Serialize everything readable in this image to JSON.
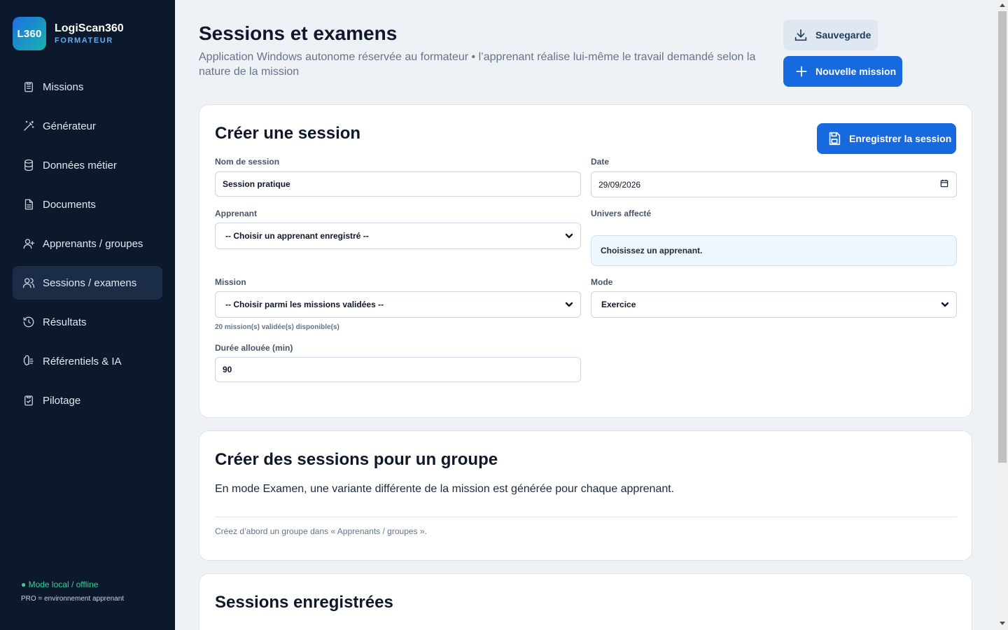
{
  "app": {
    "logo_text": "L360",
    "name": "LogiScan360",
    "role": "FORMATEUR"
  },
  "sidebar": {
    "items": [
      {
        "label": "Missions",
        "icon": "clipboard-list-icon",
        "active": false
      },
      {
        "label": "Générateur",
        "icon": "magic-wand-icon",
        "active": false
      },
      {
        "label": "Données métier",
        "icon": "database-icon",
        "active": false
      },
      {
        "label": "Documents",
        "icon": "document-icon",
        "active": false
      },
      {
        "label": "Apprenants / groupes",
        "icon": "user-plus-icon",
        "active": false
      },
      {
        "label": "Sessions / examens",
        "icon": "users-icon",
        "active": true
      },
      {
        "label": "Résultats",
        "icon": "history-icon",
        "active": false
      },
      {
        "label": "Référentiels & IA",
        "icon": "brain-icon",
        "active": false
      },
      {
        "label": "Pilotage",
        "icon": "clipboard-check-icon",
        "active": false
      }
    ],
    "status": "● Mode local / offline",
    "status_sub": "PRO = environnement apprenant",
    "status_color": "#34d399"
  },
  "header": {
    "title": "Sessions et examens",
    "subtitle": "Application Windows autonome réservée au formateur • l’apprenant réalise lui-même le travail demandé selon la nature de la mission",
    "backup_label": "Sauvegarde",
    "new_mission_label": "Nouvelle mission"
  },
  "create_session": {
    "title": "Créer une session",
    "save_label": "Enregistrer la session",
    "name_label": "Nom de session",
    "name_value": "Session pratique",
    "date_label": "Date",
    "date_value": "29/09/2026",
    "learner_label": "Apprenant",
    "learner_value": "-- Choisir un apprenant enregistré --",
    "universe_label": "Univers affecté",
    "universe_value": "Choisissez un apprenant.",
    "mission_label": "Mission",
    "mission_value": "-- Choisir parmi les missions validées --",
    "mission_hint": "20 mission(s) validée(s) disponible(s)",
    "mode_label": "Mode",
    "mode_value": "Exercice",
    "duration_label": "Durée allouée (min)",
    "duration_value": "90"
  },
  "group_sessions": {
    "title": "Créer des sessions pour un groupe",
    "description": "En mode Examen, une variante différente de la mission est générée pour chaque apprenant.",
    "hint": "Créez d’abord un groupe dans « Apprenants / groupes »."
  },
  "saved_sessions": {
    "title": "Sessions enregistrées"
  },
  "colors": {
    "sidebar_bg": "#0c182b",
    "accent": "#1769e0",
    "page_bg": "#eef2f6"
  }
}
